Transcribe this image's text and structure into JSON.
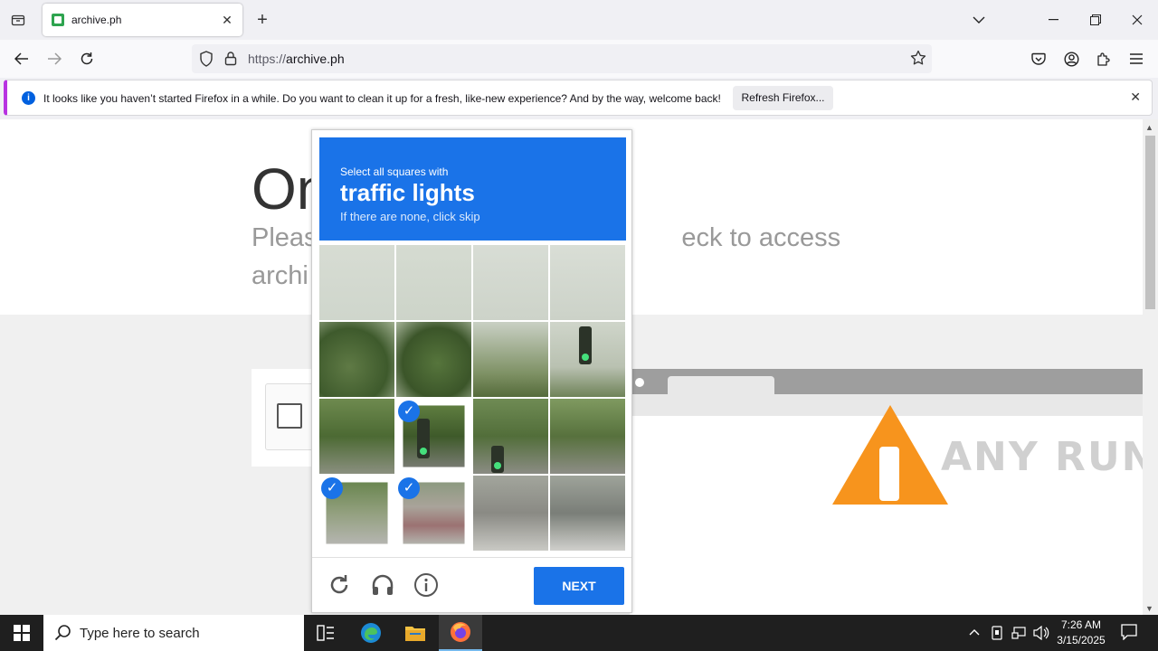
{
  "browser": {
    "tab": {
      "title": "archive.ph"
    },
    "url": {
      "protocol": "https://",
      "host": "archive.ph"
    }
  },
  "notification": {
    "message": "It looks like you haven’t started Firefox in a while. Do you want to clean it up for a fresh, like-new experience? And by the way, welcome back!",
    "button_label": "Refresh Firefox..."
  },
  "page": {
    "heading": "On",
    "subtitle_line1": "Pleas                                                  eck to access",
    "subtitle_line2": "archi"
  },
  "captcha": {
    "instruction_top": "Select all squares with",
    "target": "traffic lights",
    "hint": "If there are none, click skip",
    "next_label": "NEXT",
    "selected_cells": [
      9,
      12,
      13
    ]
  },
  "watermark": "ANY RUN",
  "taskbar": {
    "search_placeholder": "Type here to search",
    "time": "7:26 AM",
    "date": "3/15/2025"
  },
  "colors": {
    "captcha_blue": "#1a73e8",
    "warning_orange": "#f7941d"
  }
}
